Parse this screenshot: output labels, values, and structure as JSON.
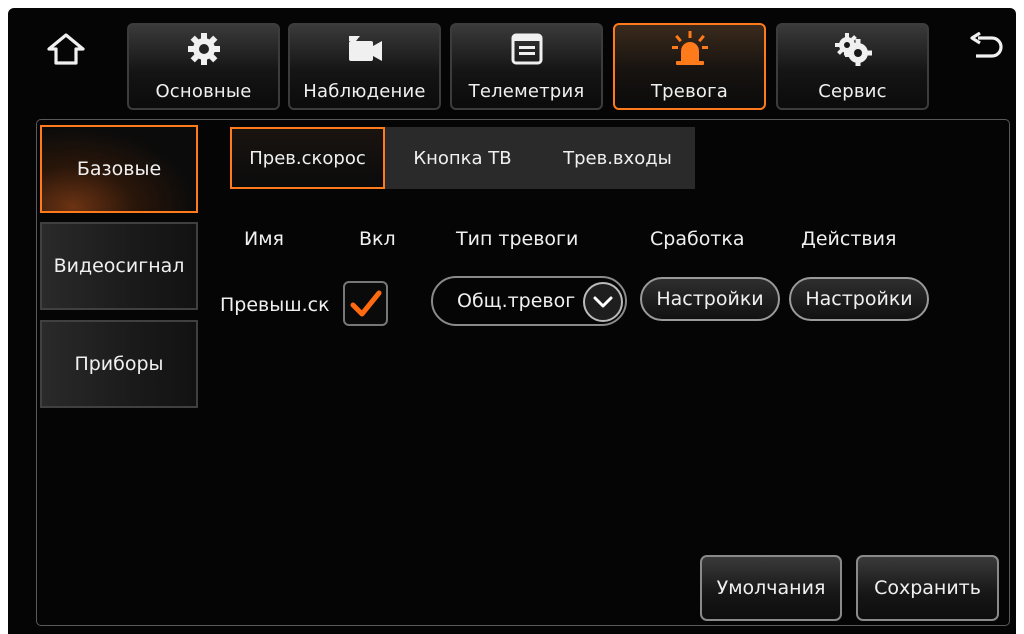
{
  "nav": {
    "home_icon": "home-icon",
    "back_icon": "back-arrow-icon",
    "tabs": [
      {
        "label": "Основные",
        "icon": "gear-icon"
      },
      {
        "label": "Наблюдение",
        "icon": "camera-icon"
      },
      {
        "label": "Телеметрия",
        "icon": "window-icon"
      },
      {
        "label": "Тревога",
        "icon": "alarm-light-icon",
        "active": true
      },
      {
        "label": "Сервис",
        "icon": "gears-icon"
      }
    ]
  },
  "sidebar": {
    "items": [
      {
        "label": "Базовые",
        "active": true
      },
      {
        "label": "Видеосигнал"
      },
      {
        "label": "Приборы"
      }
    ]
  },
  "subtabs": [
    {
      "label": "Прев.скорос",
      "active": true
    },
    {
      "label": "Кнопка ТВ"
    },
    {
      "label": "Трев.входы"
    }
  ],
  "table": {
    "headers": [
      "Имя",
      "Вкл",
      "Тип тревоги",
      "Сработка",
      "Действия"
    ],
    "row": {
      "name": "Превыш.ск",
      "enabled": true,
      "alarm_type": "Общ.тревога",
      "trigger_button": "Настройки",
      "actions_button": "Настройки"
    }
  },
  "footer": {
    "default_label": "Умолчания",
    "save_label": "Сохранить"
  },
  "colors": {
    "accent": "#ff7a1a",
    "background": "#050505",
    "text": "#f2f2f2"
  }
}
